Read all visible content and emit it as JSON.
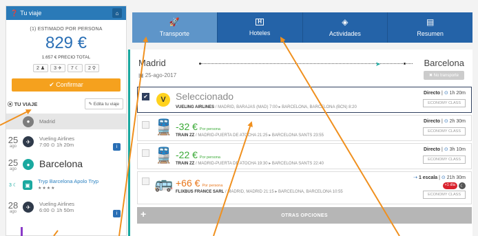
{
  "sidebar": {
    "header": {
      "title": "Tu viaje",
      "home_icon": "home-icon"
    },
    "estimated_label": "(1) ESTIMADO POR PERSONA",
    "price": "829 €",
    "total_label": "1.657 € PRECIO TOTAL",
    "pax": [
      "2 ♟",
      "3 ✈",
      "7 ☾",
      "2 ⚲"
    ],
    "confirm_label": "✔ Confirmar",
    "section_label": "TU VIAJE",
    "edit_label": "✎ Edita tu viaje",
    "timeline": [
      {
        "day": "",
        "month": "",
        "text": "Madrid",
        "icon": "map-pin-icon"
      },
      {
        "day": "25",
        "month": "ago",
        "line1": "Vueling Airlines",
        "line2": "7:00 ⊙ 1h 20m",
        "icon": "plane-icon"
      },
      {
        "day": "25",
        "month": "ago",
        "text": "Barcelona",
        "icon": "map-pin-icon"
      },
      {
        "day": "3 ☾",
        "month": "",
        "line1": "Tryp Barcelona Apolo Tryp",
        "line2": "★★★★",
        "icon": "hotel-icon"
      },
      {
        "day": "28",
        "month": "ago",
        "line1": "Vueling Airlines",
        "line2": "6:00 ⊙ 1h 50m",
        "icon": "plane-icon"
      }
    ]
  },
  "tabs": [
    {
      "label": "Transporte",
      "icon": "rocket-icon",
      "glyph": "🚀",
      "active": true
    },
    {
      "label": "Hoteles",
      "icon": "hotel-icon",
      "glyph": "H",
      "active": false
    },
    {
      "label": "Actividades",
      "icon": "ticket-icon",
      "glyph": "◈",
      "active": false
    },
    {
      "label": "Resumen",
      "icon": "document-icon",
      "glyph": "▤",
      "active": false
    }
  ],
  "trip": {
    "from": "Madrid",
    "to": "Barcelona",
    "date": "25-ago-2017",
    "no_transport_label": "✖ No transporte",
    "options": [
      {
        "heading": "Seleccionado",
        "per_person": "",
        "company": "VUELING AIRLINES",
        "route": " / MADRID, BARAJAS (MAD) 7:00 ▸ BARCELONA, BARCELONA (BCN) 8:20",
        "right_label": "Directo",
        "duration": "1h 20m",
        "class": "ECONOMY CLASS"
      },
      {
        "heading": "-32 €",
        "per_person": "Por persona",
        "company": "TRAIN ZZ",
        "route": " / MADRID-PUERTA DE ATOCHA 21:25 ▸ BARCELONA SANTS 23:55",
        "right_label": "Directo",
        "duration": "2h 30m",
        "class": "ECONOMY CLASS"
      },
      {
        "heading": "-22 €",
        "per_person": "Por persona",
        "company": "TRAIN ZZ",
        "route": " / MADRID-PUERTA DE ATOCHA 19:30 ▸ BARCELONA SANTS 22:40",
        "right_label": "Directo",
        "duration": "3h 10m",
        "class": "ECONOMY CLASS"
      },
      {
        "heading": "+66 €",
        "per_person": "Por persona",
        "company": "FLIXBUS FRANCE SARL",
        "route": " / MADRID, MADRID 21:15 ▸ BARCELONA, BARCELONA 10:55",
        "right_label": "1 escala",
        "duration": "21h 30m",
        "badge": "+1 día",
        "class": "ECONOMY CLASS"
      }
    ],
    "more_label": "OTRAS OPCIONES"
  },
  "colors": {
    "accent": "#2463a8",
    "accent_active": "#5e95c9",
    "confirm": "#f5a11e",
    "teal": "#1aa9a0",
    "arrow": "#f0901e"
  }
}
